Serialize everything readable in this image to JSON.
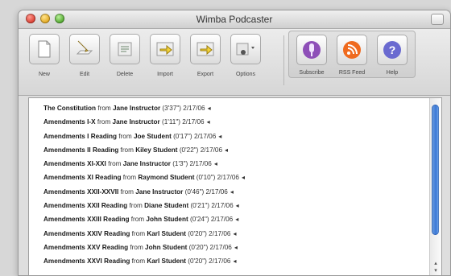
{
  "window": {
    "title": "Wimba Podcaster"
  },
  "toolbar": {
    "left": [
      {
        "label": "New",
        "icon": "new-document-icon"
      },
      {
        "label": "Edit",
        "icon": "pencil-icon"
      },
      {
        "label": "Delete",
        "icon": "delete-icon"
      },
      {
        "label": "Import",
        "icon": "import-arrow-icon"
      },
      {
        "label": "Export",
        "icon": "export-arrow-icon"
      },
      {
        "label": "Options",
        "icon": "gear-options-icon"
      }
    ],
    "right": [
      {
        "label": "Subscribe",
        "icon": "microphone-icon"
      },
      {
        "label": "RSS Feed",
        "icon": "rss-icon"
      },
      {
        "label": "Help",
        "icon": "question-icon"
      }
    ]
  },
  "episodes": [
    {
      "title": "The Constitution",
      "by": "from",
      "author": "Jane Instructor",
      "duration": "(3'37\")",
      "date": "2/17/06"
    },
    {
      "title": "Amendments I-X",
      "by": "from",
      "author": "Jane Instructor",
      "duration": "(1'11\")",
      "date": "2/17/06"
    },
    {
      "title": "Amendments I Reading",
      "by": "from",
      "author": "Joe Student",
      "duration": "(0'17\")",
      "date": "2/17/06"
    },
    {
      "title": "Amendments II Reading",
      "by": "from",
      "author": "Kiley Student",
      "duration": "(0'22\")",
      "date": "2/17/06"
    },
    {
      "title": "Amendments XI-XXI",
      "by": "from",
      "author": "Jane Instructor",
      "duration": "(1'3\")",
      "date": "2/17/06"
    },
    {
      "title": "Amendments XI Reading",
      "by": "from",
      "author": "Raymond Student",
      "duration": "(0'10\")",
      "date": "2/17/06"
    },
    {
      "title": "Amendments XXII-XXVII",
      "by": "from",
      "author": "Jane Instructor",
      "duration": "(0'46\")",
      "date": "2/17/06"
    },
    {
      "title": "Amendments XXII Reading",
      "by": "from",
      "author": "Diane Student",
      "duration": "(0'21\")",
      "date": "2/17/06"
    },
    {
      "title": "Amendments XXIII Reading",
      "by": "from",
      "author": "John Student",
      "duration": "(0'24\")",
      "date": "2/17/06"
    },
    {
      "title": "Amendments XXIV Reading",
      "by": "from",
      "author": "Karl Student",
      "duration": "(0'20\")",
      "date": "2/17/06"
    },
    {
      "title": "Amendments XXV Reading",
      "by": "from",
      "author": "John Student",
      "duration": "(0'20\")",
      "date": "2/17/06"
    },
    {
      "title": "Amendments XXVI Reading",
      "by": "from",
      "author": "Karl Student",
      "duration": "(0'20\")",
      "date": "2/17/06"
    }
  ]
}
